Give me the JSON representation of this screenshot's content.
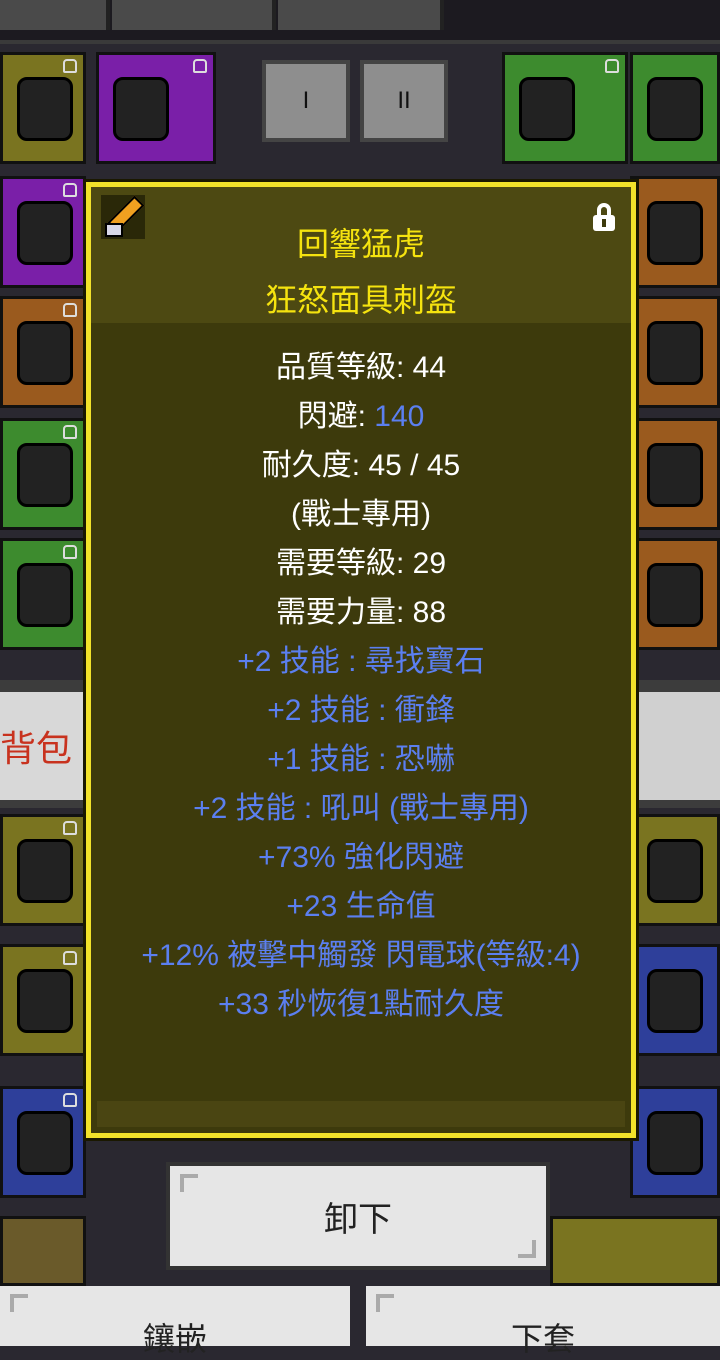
{
  "tabs": {
    "tab1": "I",
    "tab2": "II"
  },
  "backpack_tab_label": "背包 (",
  "tooltip": {
    "name_line1": "回響猛虎",
    "name_line2": "狂怒面具刺盔",
    "stats": {
      "quality_label": "品質等級: ",
      "quality_value": "44",
      "dodge_label": "閃避: ",
      "dodge_value": "140",
      "durability_label": "耐久度: ",
      "durability_value": "45 / 45",
      "class_restriction": "(戰士專用)",
      "req_level_label": "需要等級: ",
      "req_level_value": "29",
      "req_str_label": "需要力量: ",
      "req_str_value": "88"
    },
    "affixes": [
      "+2 技能 : 尋找寶石",
      "+2 技能 : 衝鋒",
      "+1 技能 : 恐嚇",
      "+2 技能 : 吼叫 (戰士專用)",
      "+73% 強化閃避",
      "+23 生命值",
      "+12% 被擊中觸發 閃電球(等級:4)",
      "+33 秒恢復1點耐久度"
    ]
  },
  "buttons": {
    "unequip": "卸下",
    "bottom_left": "鑲嵌",
    "bottom_right": "下套"
  },
  "colors": {
    "name": "#f5e30f",
    "affix_blue": "#5b7ff0",
    "panel_bg": "#3d3a0c",
    "panel_border": "#f2e22a"
  },
  "icons": {
    "item_icon": "sword-icon",
    "lock_icon": "lock-icon"
  }
}
